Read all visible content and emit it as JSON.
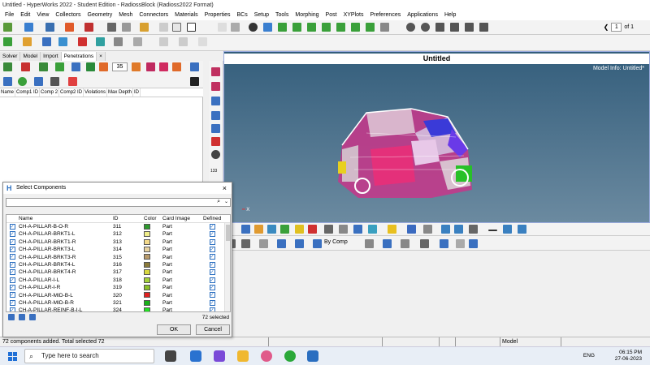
{
  "window": {
    "title": "Untitled - HyperWorks 2022 - Student Edition - RadiossBlock (Radioss2022 Format)"
  },
  "menu": [
    "File",
    "Edit",
    "View",
    "Collectors",
    "Geometry",
    "Mesh",
    "Connectors",
    "Materials",
    "Properties",
    "BCs",
    "Setup",
    "Tools",
    "Morphing",
    "Post",
    "XYPlots",
    "Preferences",
    "Applications",
    "Help"
  ],
  "pager": {
    "current": "1",
    "of_label": "of 1"
  },
  "left_tabs": [
    {
      "label": "Solver",
      "active": false
    },
    {
      "label": "Model",
      "active": false
    },
    {
      "label": "Import",
      "active": false
    },
    {
      "label": "Penetrations",
      "active": true
    },
    {
      "label": "×",
      "active": false
    }
  ],
  "penetrations": {
    "threshold_value": "35",
    "columns": [
      "Name",
      "Comp1 ID",
      "Comp 2",
      "Comp2 ID",
      "Violations",
      "Max Depth",
      "ID"
    ]
  },
  "viewport": {
    "title": "Untitled",
    "model_info": "Model Info: Untitled*",
    "axis_label": "X"
  },
  "vstrip_label": "133",
  "bottom_toolbar": {
    "by_comp_label": "By Comp"
  },
  "dialog": {
    "title": "Select Components",
    "search_value": "",
    "columns": {
      "name": "Name",
      "id": "ID",
      "color": "Color",
      "card_image": "Card Image",
      "defined": "Defined"
    },
    "rows": [
      {
        "name": "CH-A-PILLAR-B-O-R",
        "id": "311",
        "color": "#2e9a2e",
        "card": "Part"
      },
      {
        "name": "CH-A-PILLAR-BRKT1-L",
        "id": "312",
        "color": "#f0ee8a",
        "card": "Part"
      },
      {
        "name": "CH-A-PILLAR-BRKT1-R",
        "id": "313",
        "color": "#f3d98a",
        "card": "Part"
      },
      {
        "name": "CH-A-PILLAR-BRKT3-L",
        "id": "314",
        "color": "#e8d3a0",
        "card": "Part"
      },
      {
        "name": "CH-A-PILLAR-BRKT3-R",
        "id": "315",
        "color": "#b89a6a",
        "card": "Part"
      },
      {
        "name": "CH-A-PILLAR-BRKT4-L",
        "id": "316",
        "color": "#8a7a3a",
        "card": "Part"
      },
      {
        "name": "CH-A-PILLAR-BRKT4-R",
        "id": "317",
        "color": "#d8d840",
        "card": "Part"
      },
      {
        "name": "CH-A-PILLAR-I-L",
        "id": "318",
        "color": "#a4d23a",
        "card": "Part"
      },
      {
        "name": "CH-A-PILLAR-I-R",
        "id": "319",
        "color": "#8ac028",
        "card": "Part"
      },
      {
        "name": "CH-A-PILLAR-MID-B-L",
        "id": "320",
        "color": "#e02020",
        "card": "Part"
      },
      {
        "name": "CH-A-PILLAR-MID-B-R",
        "id": "321",
        "color": "#18b018",
        "card": "Part"
      },
      {
        "name": "CH-A-PILLAR-REINF-B-I-L",
        "id": "324",
        "color": "#22e022",
        "card": "Part"
      }
    ],
    "selected_count": "72 selected",
    "ok_label": "OK",
    "cancel_label": "Cancel"
  },
  "status": {
    "message": "72 components added. Total selected 72",
    "model_label": "Model"
  },
  "taskbar": {
    "search_placeholder": "Type here to search",
    "language": "ENG",
    "time": "06:15 PM",
    "date": "27-06-2023"
  },
  "colors": {
    "viewport_top": "#345e7c",
    "viewport_bottom": "#6b8aa0",
    "accent": "#2a6ec0"
  }
}
